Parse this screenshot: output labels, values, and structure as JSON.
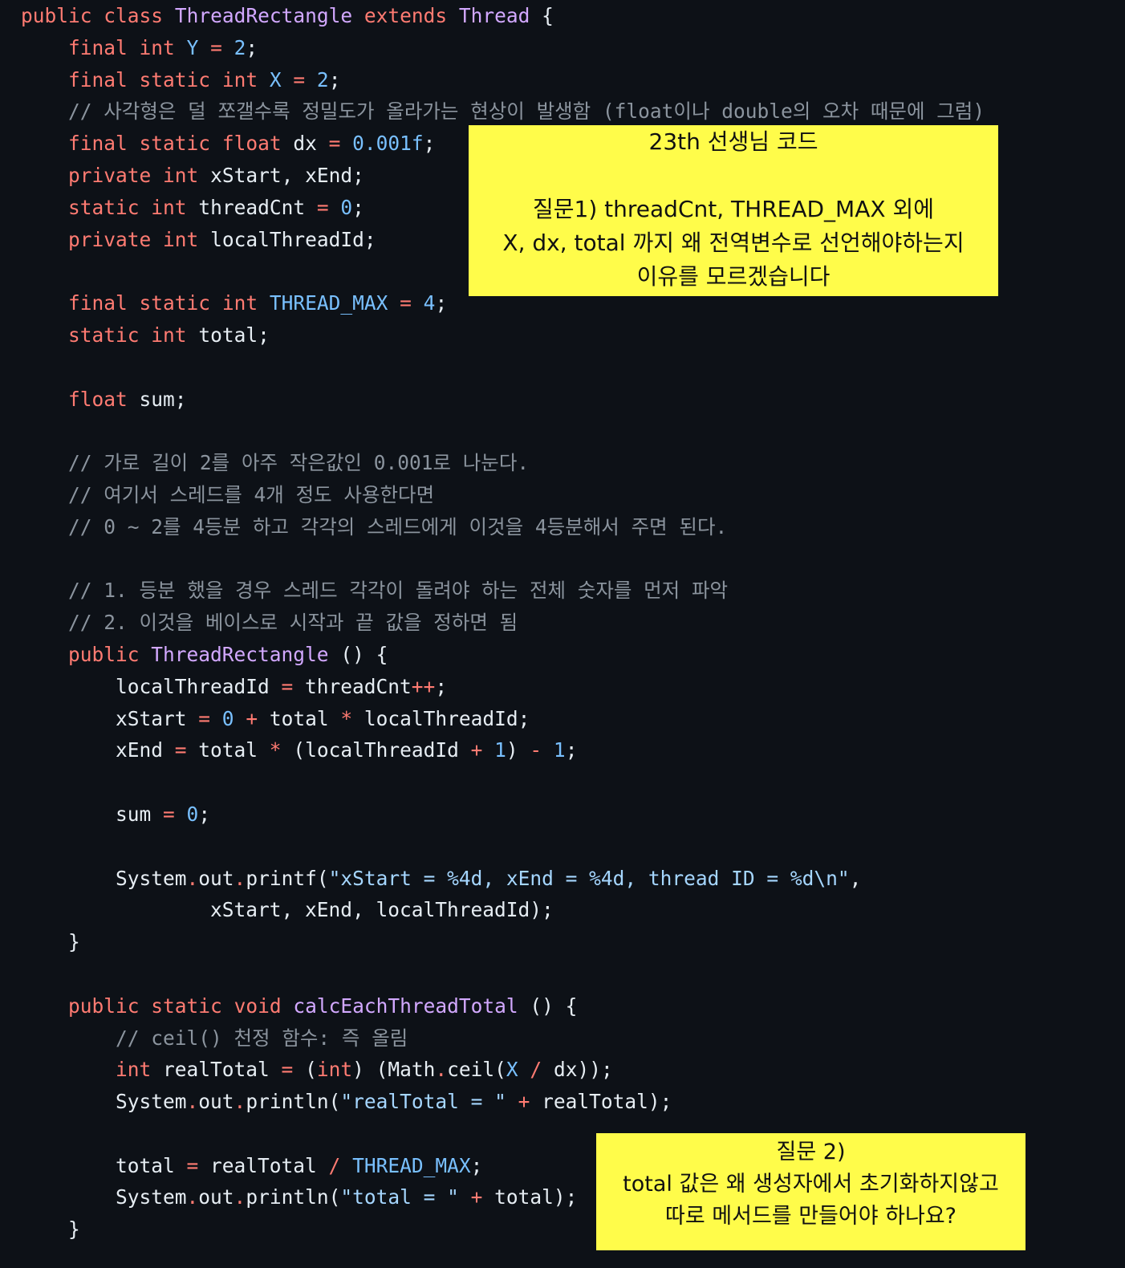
{
  "code_lines": [
    "public class ThreadRectangle extends Thread {",
    "    final int Y = 2;",
    "    final static int X = 2;",
    "    // 사각형은 덜 쪼갤수록 정밀도가 올라가는 현상이 발생함 (float이나 double의 오차 때문에 그럼)",
    "    final static float dx = 0.001f;",
    "    private int xStart, xEnd;",
    "    static int threadCnt = 0;",
    "    private int localThreadId;",
    "",
    "    final static int THREAD_MAX = 4;",
    "    static int total;",
    "",
    "    float sum;",
    "",
    "    // 가로 길이 2를 아주 작은값인 0.001로 나눈다.",
    "    // 여기서 스레드를 4개 정도 사용한다면",
    "    // 0 ~ 2를 4등분 하고 각각의 스레드에게 이것을 4등분해서 주면 된다.",
    "",
    "    // 1. 등분 했을 경우 스레드 각각이 돌려야 하는 전체 숫자를 먼저 파악",
    "    // 2. 이것을 베이스로 시작과 끝 값을 정하면 됨",
    "    public ThreadRectangle () {",
    "        localThreadId = threadCnt++;",
    "        xStart = 0 + total * localThreadId;",
    "        xEnd = total * (localThreadId + 1) - 1;",
    "",
    "        sum = 0;",
    "",
    "        System.out.printf(\"xStart = %4d, xEnd = %4d, thread ID = %d\\n\",",
    "                xStart, xEnd, localThreadId);",
    "    }",
    "",
    "    public static void calcEachThreadTotal () {",
    "        // ceil() 천정 함수: 즉 올림",
    "        int realTotal = (int) (Math.ceil(X / dx));",
    "        System.out.println(\"realTotal = \" + realTotal);",
    "",
    "        total = realTotal / THREAD_MAX;",
    "        System.out.println(\"total = \" + total);",
    "    }"
  ],
  "note1": {
    "lines": [
      "23th 선생님 코드",
      "",
      "질문1) threadCnt, THREAD_MAX 외에",
      "X, dx, total 까지 왜 전역변수로 선언해야하는지",
      "이유를 모르겠습니다"
    ]
  },
  "note2": {
    "lines": [
      "질문 2)",
      "total 값은 왜 생성자에서 초기화하지않고",
      "따로 메서드를 만들어야 하나요?"
    ]
  },
  "colors": {
    "background": "#0d1117",
    "keyword": "#ff7b72",
    "class_name": "#d2a8ff",
    "number": "#79c0ff",
    "string": "#a5d6ff",
    "comment": "#8b949e",
    "note_background": "#fffc4a"
  }
}
